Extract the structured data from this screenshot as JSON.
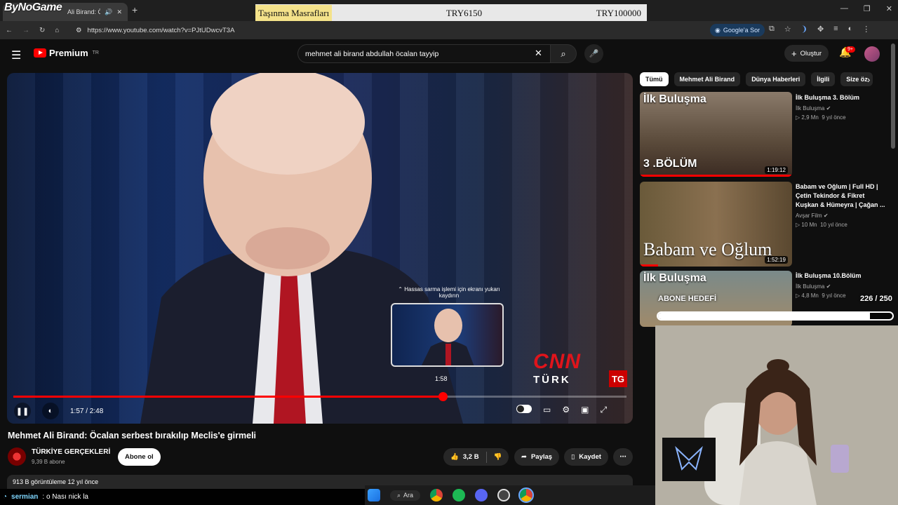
{
  "browser": {
    "tab_title": "Ali Birand: Öca",
    "url": "https://www.youtube.com/watch?v=PJtUDwcvT3A",
    "google_button": "Google'a Sor",
    "overlay_brand": "ByNoGame"
  },
  "cost_bar": {
    "label": "Taşınma Masrafları",
    "current": "TRY6150",
    "target": "TRY100000"
  },
  "youtube": {
    "logo_text": "Premium",
    "logo_region": "TR",
    "search_value": "mehmet ali birand abdullah öcalan tayyip",
    "create_label": "Oluştur",
    "notif_badge": "9+"
  },
  "player": {
    "scrub_hint": "Hassas sarma işlemi için ekranı yukarı kaydırın",
    "preview_time": "1:58",
    "time_display": "1:57 / 2:48",
    "progress": 0.7,
    "logo_cnn": "CNN",
    "logo_turk": "TÜRK",
    "logo_tg": "TG"
  },
  "video": {
    "title": "Mehmet Ali Birand: Öcalan serbest bırakılıp Meclis'e girmeli",
    "channel": "TÜRKİYE GERÇEKLERİ",
    "subs": "9,39 B abone",
    "subscribe_label": "Abone ol",
    "likes": "3,2 B",
    "share_label": "Paylaş",
    "save_label": "Kaydet",
    "views_line": "913 B görüntüleme  12 yıl önce"
  },
  "chips": [
    "Tümü",
    "Mehmet Ali Birand",
    "Dünya Haberleri",
    "İlgili",
    "Size öz"
  ],
  "recommendations": [
    {
      "title": "İlk Buluşma 3. Bölüm",
      "channel": "İlk Buluşma",
      "views": "2,9 Mn",
      "age": "9 yıl önce",
      "duration": "1:19:12",
      "overlay_top": "İlk Buluşma",
      "overlay_bottom": "3 .BÖLÜM",
      "watched": 1.0
    },
    {
      "title": "Babam ve Oğlum | Full HD | Çetin Tekindor & Fikret Kuşkan & Hümeyra | Çağan ...",
      "channel": "Avşar Film",
      "views": "10 Mn",
      "age": "10 yıl önce",
      "duration": "1:52:19",
      "overlay_top": "",
      "overlay_bottom": "Babam ve Oğlum",
      "watched": 0.12
    },
    {
      "title": "İlk Buluşma 10.Bölüm",
      "channel": "İlk Buluşma",
      "views": "4,8 Mn",
      "age": "9 yıl önce",
      "duration": "",
      "overlay_top": "İlk Buluşma",
      "overlay_bottom": "",
      "watched": 0
    }
  ],
  "sub_goal": {
    "label": "ABONE HEDEFİ",
    "count": "226 / 250",
    "current": 226,
    "target": 250
  },
  "chat": {
    "user": "sermian",
    "message": ": o Nası nick la"
  },
  "taskbar": {
    "search_label": "Ara"
  },
  "colors": {
    "yt_red": "#ff0000",
    "bg": "#0f0f0f",
    "chip_bg": "#272727"
  }
}
